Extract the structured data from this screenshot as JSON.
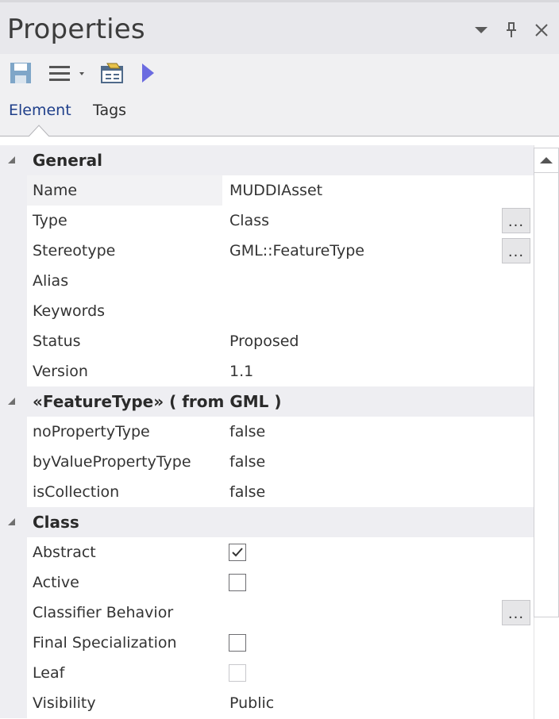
{
  "window": {
    "title": "Properties",
    "controls": {
      "dropdown": "chevron-down-icon",
      "pin": "pin-icon",
      "close": "close-icon"
    }
  },
  "toolbar": {
    "items": [
      "save-icon",
      "list-menu-icon",
      "properties-dialog-icon",
      "play-icon"
    ]
  },
  "tabs": [
    {
      "label": "Element",
      "active": true
    },
    {
      "label": "Tags",
      "active": false
    }
  ],
  "general": {
    "label": "General",
    "props": [
      {
        "name": "Name",
        "value": "MUDDIAsset"
      },
      {
        "name": "Type",
        "value": "Class",
        "has_button": true,
        "button_label": "..."
      },
      {
        "name": "Stereotype",
        "value": "GML::FeatureType",
        "has_button": true,
        "button_label": "..."
      },
      {
        "name": "Alias",
        "value": ""
      },
      {
        "name": "Keywords",
        "value": ""
      },
      {
        "name": "Status",
        "value": "Proposed"
      },
      {
        "name": "Version",
        "value": "1.1"
      }
    ]
  },
  "feature_type": {
    "label": "«FeatureType»  ( from GML )",
    "props": [
      {
        "name": "noPropertyType",
        "value": "false"
      },
      {
        "name": "byValuePropertyType",
        "value": "false"
      },
      {
        "name": "isCollection",
        "value": "false"
      }
    ]
  },
  "class": {
    "label": "Class",
    "props": [
      {
        "name": "Abstract",
        "checked": true
      },
      {
        "name": "Active",
        "checked": false
      },
      {
        "name": "Classifier Behavior",
        "value": "",
        "has_button": true,
        "button_label": "..."
      },
      {
        "name": "Final Specialization",
        "checked": false
      },
      {
        "name": "Leaf",
        "checked": false,
        "disabled": true
      },
      {
        "name": "Visibility",
        "value": "Public"
      }
    ]
  },
  "colors": {
    "title_bar": "#e8e8ec",
    "category_bg": "#eeeef2",
    "active_tab": "#1f3f8a",
    "play_icon": "#6b6be0"
  }
}
